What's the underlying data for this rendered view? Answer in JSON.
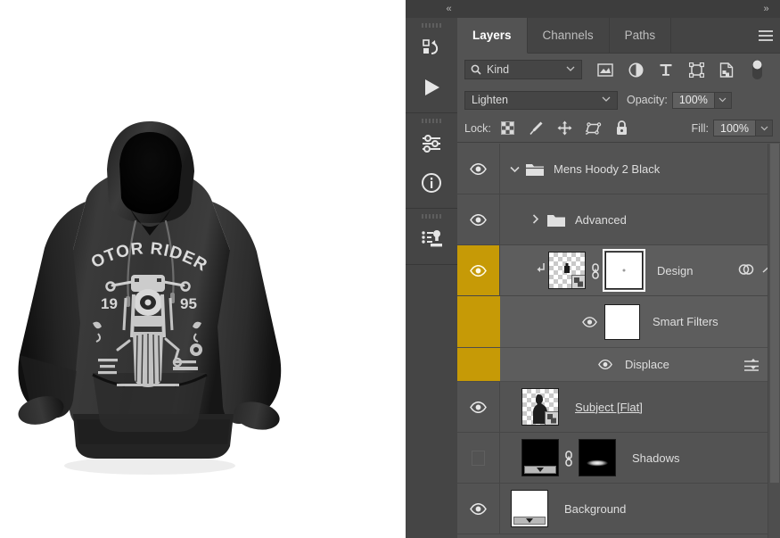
{
  "dock": {
    "collapse_left_icon": "double-chevron-left",
    "collapse_right_icon": "double-chevron-right",
    "rail_icons": [
      "history-actions-icon",
      "play-icon",
      "adjustments-icon",
      "info-icon",
      "clone-source-icon"
    ]
  },
  "tabs": [
    {
      "label": "Layers",
      "active": true
    },
    {
      "label": "Channels",
      "active": false
    },
    {
      "label": "Paths",
      "active": false
    }
  ],
  "panel_menu_icon": "hamburger-menu-icon",
  "filter": {
    "search_icon": "search-icon",
    "kind_value": "Kind",
    "chevron_icon": "chevron-down-icon",
    "icons": [
      "pixel-layer-filter-icon",
      "adjustment-layer-filter-icon",
      "type-layer-filter-icon",
      "shape-layer-filter-icon",
      "smart-object-filter-icon",
      "filter-toggle-switch"
    ]
  },
  "blend": {
    "mode": "Lighten",
    "opacity_label": "Opacity:",
    "opacity_value": "100%",
    "chevron_icon": "chevron-down-icon"
  },
  "lock": {
    "label": "Lock:",
    "icons": [
      "lock-transparent-pixels-icon",
      "lock-image-pixels-icon",
      "lock-position-icon",
      "lock-artboard-nesting-icon",
      "lock-all-icon"
    ],
    "fill_label": "Fill:",
    "fill_value": "100%"
  },
  "layers": [
    {
      "name": "Mens Hoody 2 Black",
      "type": "group",
      "visible": true,
      "expanded": true,
      "selected": false,
      "disclosure_icon": "chevron-down-icon",
      "icon": "folder-open-icon",
      "eye_icon": "eye-icon"
    },
    {
      "name": "Advanced",
      "type": "group",
      "visible": true,
      "expanded": false,
      "selected": false,
      "disclosure_icon": "chevron-right-icon",
      "icon": "folder-icon",
      "eye_icon": "eye-icon"
    },
    {
      "name": "Design",
      "type": "smart-object",
      "visible": true,
      "selected": true,
      "clipped": true,
      "clip_icon": "clipping-mask-arrow-icon",
      "link_icon": "link-mask-icon",
      "has_mask": true,
      "mask_selected": true,
      "eye_icon": "eye-icon",
      "fx_icons": [
        "smart-filters-icon",
        "collapse-chevron-icon"
      ]
    },
    {
      "name": "Smart Filters",
      "type": "smart-filter-header",
      "visible": true,
      "eye_icon": "eye-icon",
      "has_mask": true
    },
    {
      "name": "Displace",
      "type": "smart-filter",
      "visible": true,
      "eye_icon": "eye-icon",
      "settings_icon": "filter-blending-options-icon"
    },
    {
      "name": "Subject [Flat]",
      "type": "smart-object",
      "visible": true,
      "selected": false,
      "underlined": true,
      "eye_icon": "eye-icon"
    },
    {
      "name": "Shadows",
      "type": "pixel",
      "visible": false,
      "selected": false,
      "link_icon": "link-mask-icon",
      "has_mask": true,
      "eye_icon": "eye-hidden-placeholder"
    },
    {
      "name": "Background",
      "type": "background",
      "visible": true,
      "selected": false,
      "eye_icon": "eye-icon"
    }
  ],
  "colors": {
    "panel_bg": "#535353",
    "rail_bg": "#454545",
    "topbar_bg": "#3d3d3d",
    "tab_bg": "#444444",
    "selected_row": "#5d5d5d",
    "selection_gold": "#c69a06",
    "text": "#dedede"
  },
  "artwork": {
    "garment": "black-hoodie-mockup",
    "print_title": "MOTOR RIDERS",
    "print_year_left": "19",
    "print_year_right": "95"
  }
}
